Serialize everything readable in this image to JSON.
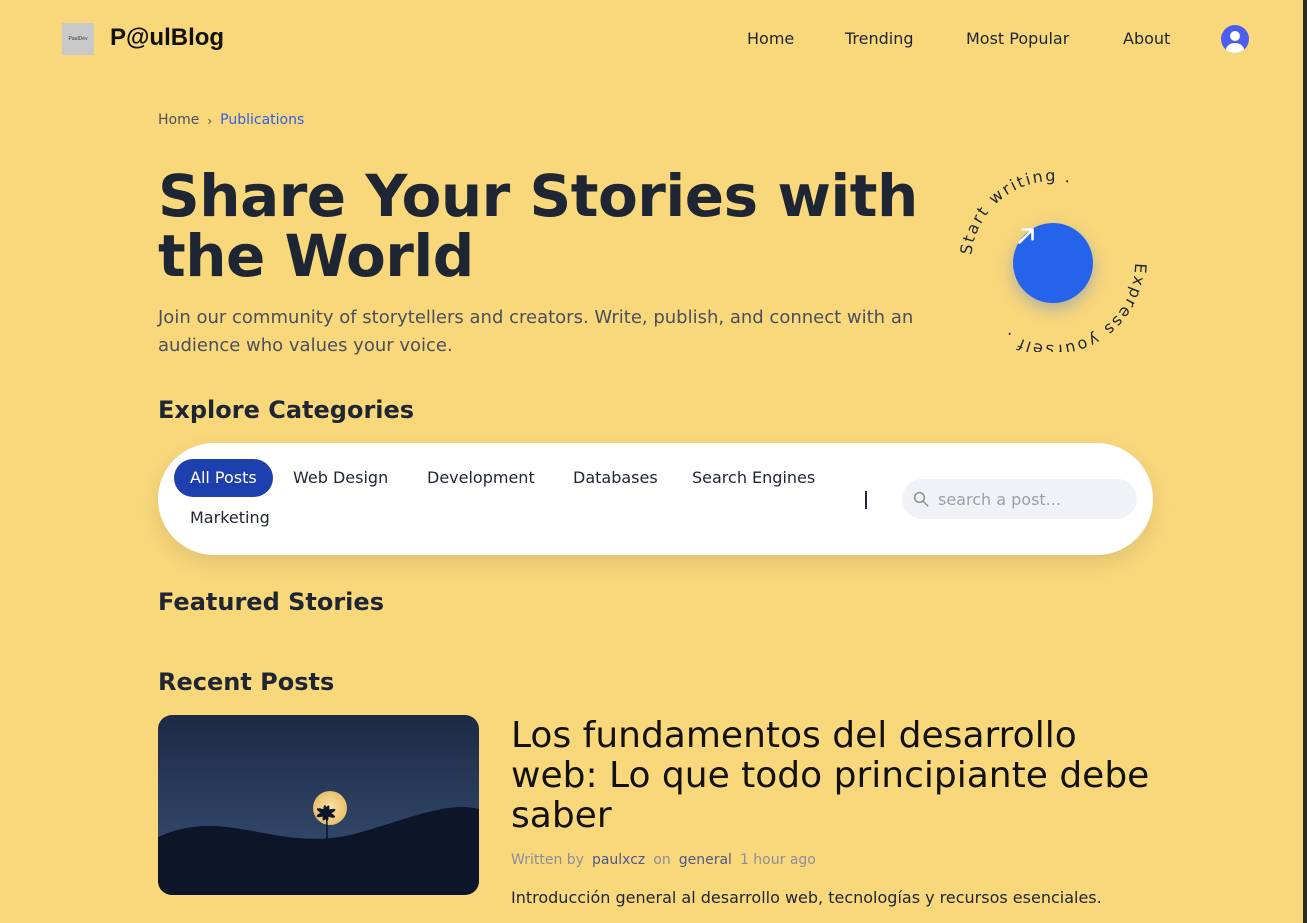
{
  "header": {
    "logo_text": "PaulDev",
    "brand": "P@ulBlog",
    "nav": [
      "Home",
      "Trending",
      "Most Popular",
      "About"
    ]
  },
  "breadcrumb": {
    "home": "Home",
    "separator": "›",
    "current": "Publications"
  },
  "hero": {
    "title": "Share Your Stories with the World",
    "subtitle": "Join our community of storytellers and creators. Write, publish, and connect with an audience who values your voice.",
    "badge_text_top": "Start writing .",
    "badge_text_bottom": "Express yourself ."
  },
  "categories": {
    "heading": "Explore Categories",
    "items": [
      "All Posts",
      "Web Design",
      "Development",
      "Databases",
      "Search Engines",
      "Marketing"
    ],
    "active": "All Posts",
    "search_placeholder": "search a post..."
  },
  "featured": {
    "heading": "Featured Stories"
  },
  "recent": {
    "heading": "Recent Posts",
    "post": {
      "title": "Los fundamentos del desarrollo web: Lo que todo principiante debe saber",
      "written_by_label": "Written by",
      "author": "paulxcz",
      "on_label": "on",
      "category": "general",
      "time": "1 hour ago",
      "excerpt": "Introducción general al desarrollo web, tecnologías y recursos esenciales."
    }
  },
  "colors": {
    "background": "#f9d77b",
    "accent": "#2563eb",
    "active_chip": "#1e40af",
    "text": "#1e2533"
  }
}
